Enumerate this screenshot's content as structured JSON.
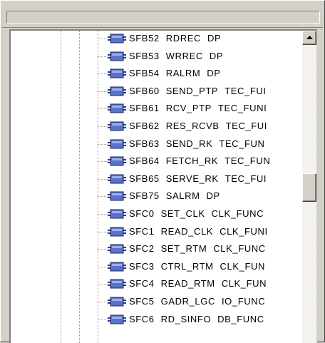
{
  "tree": {
    "items": [
      {
        "number": "SFB52",
        "name": "RDREC",
        "family": "DP"
      },
      {
        "number": "SFB53",
        "name": "WRREC",
        "family": "DP"
      },
      {
        "number": "SFB54",
        "name": "RALRM",
        "family": "DP"
      },
      {
        "number": "SFB60",
        "name": "SEND_PTP",
        "family": "TEC_FUI"
      },
      {
        "number": "SFB61",
        "name": "RCV_PTP",
        "family": "TEC_FUNI"
      },
      {
        "number": "SFB62",
        "name": "RES_RCVB",
        "family": "TEC_FUI"
      },
      {
        "number": "SFB63",
        "name": "SEND_RK",
        "family": "TEC_FUN"
      },
      {
        "number": "SFB64",
        "name": "FETCH_RK",
        "family": "TEC_FUN"
      },
      {
        "number": "SFB65",
        "name": "SERVE_RK",
        "family": "TEC_FUI"
      },
      {
        "number": "SFB75",
        "name": "SALRM",
        "family": "DP"
      },
      {
        "number": "SFC0",
        "name": "SET_CLK",
        "family": "CLK_FUNC"
      },
      {
        "number": "SFC1",
        "name": "READ_CLK",
        "family": "CLK_FUNI"
      },
      {
        "number": "SFC2",
        "name": "SET_RTM",
        "family": "CLK_FUNC"
      },
      {
        "number": "SFC3",
        "name": "CTRL_RTM",
        "family": "CLK_FUN"
      },
      {
        "number": "SFC4",
        "name": "READ_RTM",
        "family": "CLK_FUN"
      },
      {
        "number": "SFC5",
        "name": "GADR_LGC",
        "family": "IO_FUNC"
      },
      {
        "number": "SFC6",
        "name": "RD_SINFO",
        "family": "DB_FUNC"
      }
    ]
  },
  "icons": {
    "block": "function-block-icon",
    "scroll_up": "arrow-up-icon"
  },
  "colors": {
    "icon_fill": "#2a3c8f",
    "icon_light": "#5a73c8",
    "background": "#ffffff",
    "chrome": "#d4d0c8"
  }
}
